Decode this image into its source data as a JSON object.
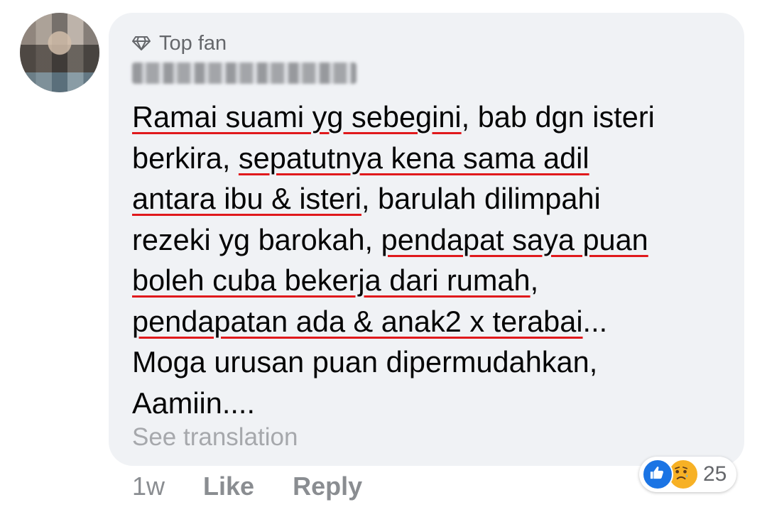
{
  "comment": {
    "badge": "Top fan",
    "lines": [
      [
        {
          "t": "Ramai suami yg sebegini",
          "u": true
        },
        {
          "t": ", bab dgn isteri",
          "u": false
        }
      ],
      [
        {
          "t": "berkira, ",
          "u": false
        },
        {
          "t": "sepatutnya kena sama adil",
          "u": true
        }
      ],
      [
        {
          "t": "antara ibu & isteri",
          "u": true
        },
        {
          "t": ", barulah dilimpahi",
          "u": false
        }
      ],
      [
        {
          "t": "rezeki yg barokah, ",
          "u": false
        },
        {
          "t": "pendapat saya puan",
          "u": true
        }
      ],
      [
        {
          "t": "boleh cuba bekerja dari rumah",
          "u": true
        },
        {
          "t": ",",
          "u": false
        }
      ],
      [
        {
          "t": "pendapatan ada & anak2 x terabai",
          "u": true
        },
        {
          "t": "...",
          "u": false
        }
      ],
      [
        {
          "t": "Moga urusan puan dipermudahkan,",
          "u": false
        }
      ],
      [
        {
          "t": "Aamiin....",
          "u": false
        }
      ]
    ],
    "see_translation": "See translation",
    "time": "1w",
    "like_label": "Like",
    "reply_label": "Reply",
    "reaction_count": "25",
    "reaction_icons": [
      "like-icon",
      "sad-icon"
    ]
  },
  "colors": {
    "bubble": "#f0f2f5",
    "underline": "#e0191c",
    "meta_text": "#8a8d91",
    "like_blue": "#1b74e4",
    "sad_yellow": "#f7b125"
  }
}
